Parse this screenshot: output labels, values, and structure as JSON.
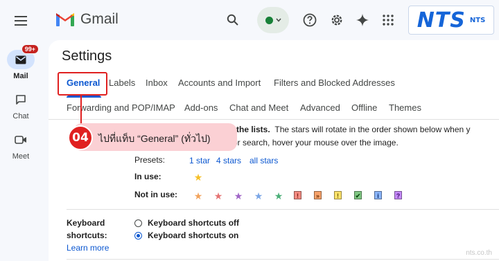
{
  "rail": {
    "mail_label": "Mail",
    "badge": "99+",
    "chat_label": "Chat",
    "meet_label": "Meet"
  },
  "header": {
    "app_name": "Gmail",
    "brand_big": "NTS",
    "brand_small": "NTS"
  },
  "settings": {
    "title": "Settings",
    "tabs_row1": [
      "General",
      "Labels",
      "Inbox",
      "Accounts and Import",
      "Filters and Blocked Addresses"
    ],
    "tabs_row2": [
      "Forwarding and POP/IMAP",
      "Add-ons",
      "Chat and Meet",
      "Advanced",
      "Offline",
      "Themes"
    ],
    "active_tab": "General",
    "stars": {
      "line1_bold": "the lists.",
      "line1_rest": "The stars will rotate in the order shown below when y",
      "line2": "or search, hover your mouse over the image.",
      "presets_label": "Presets:",
      "preset_links": [
        "1 star",
        "4 stars",
        "all stars"
      ],
      "in_use_label": "In use:",
      "not_in_use_label": "Not in use:"
    },
    "keyboard": {
      "label_line1": "Keyboard",
      "label_line2": "shortcuts:",
      "learn_more": "Learn more",
      "option_off": "Keyboard shortcuts off",
      "option_on": "Keyboard shortcuts on",
      "selected": "on"
    }
  },
  "callout": {
    "number": "04",
    "text": "ไปที่แท็บ “General” (ทั่วไป)"
  },
  "watermark": "nts.co.th",
  "colors": {
    "accent": "#0b57d0",
    "callout_red": "#e02020",
    "callout_bg": "#fbd0d4"
  }
}
